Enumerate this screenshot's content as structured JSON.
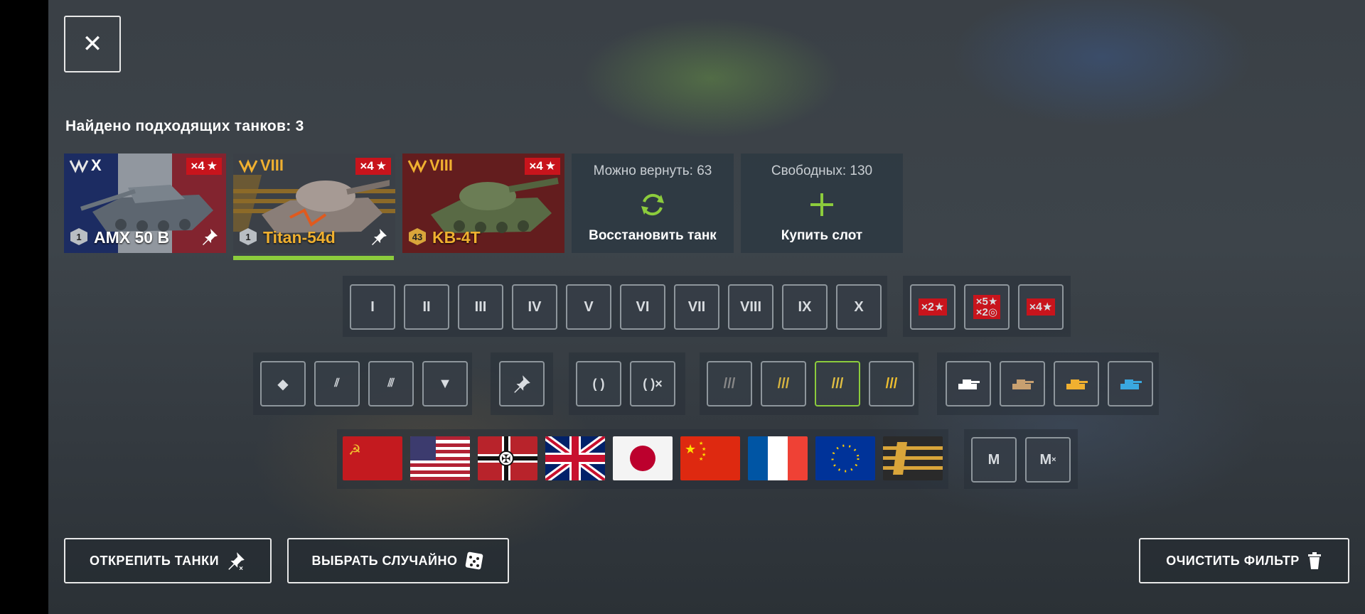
{
  "close_label": "✕",
  "found_title": "Найдено подходящих танков: 3",
  "tanks": [
    {
      "tier": "X",
      "name": "AMX 50 B",
      "multiplier": "×4",
      "badge": "1",
      "name_color": "#ffffff"
    },
    {
      "tier": "VIII",
      "name": "Titan-54d",
      "multiplier": "×4",
      "badge": "1",
      "name_color": "#f0b030"
    },
    {
      "tier": "VIII",
      "name": "KB-4T",
      "multiplier": "×4",
      "badge": "43",
      "name_color": "#f0b030"
    }
  ],
  "restore_card": {
    "top": "Можно вернуть: 63",
    "label": "Восстановить танк"
  },
  "slot_card": {
    "top": "Свободных: 130",
    "label": "Купить слот"
  },
  "tier_filters": [
    "I",
    "II",
    "III",
    "IV",
    "V",
    "VI",
    "VII",
    "VIII",
    "IX",
    "X"
  ],
  "multiplier_filters": [
    "×2",
    "×5",
    "×2",
    "×4"
  ],
  "role_icons": [
    "diamond-rank-icon",
    "two-stripe-rank-icon",
    "three-stripe-rank-icon",
    "triangle-rank-icon"
  ],
  "mastery_icons": [
    "laurel-icon",
    "laurel-x-icon"
  ],
  "class_icons": [
    "light-tank-icon",
    "medium-tank-icon",
    "heavy-tank-icon",
    "premium-tank-icon"
  ],
  "nations": [
    "ussr",
    "usa",
    "germany",
    "uk",
    "japan",
    "china",
    "france",
    "europe",
    "other"
  ],
  "premium_filters": [
    "M",
    "M"
  ],
  "buttons": {
    "unpin": "ОТКРЕПИТЬ ТАНКИ",
    "random": "ВЫБРАТЬ СЛУЧАЙНО",
    "clear": "ОЧИСТИТЬ ФИЛЬТР"
  },
  "colors": {
    "accent_green": "#8ccc3c",
    "badge_red": "#c8141c",
    "gold": "#f0b030"
  }
}
